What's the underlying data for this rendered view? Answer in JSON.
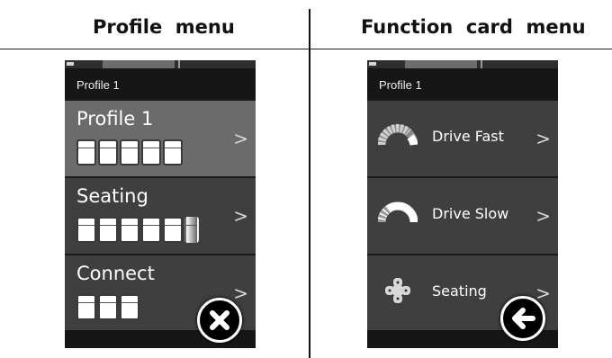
{
  "headings": {
    "left": "Profile  menu",
    "right": "Function  card  menu"
  },
  "profile_menu": {
    "title": "Profile 1",
    "chevron": ">",
    "items": [
      {
        "label": "Profile 1",
        "segments": 5,
        "selected": true
      },
      {
        "label": "Seating",
        "segments": 6,
        "selected": false
      },
      {
        "label": "Connect",
        "segments": 3,
        "selected": false
      }
    ],
    "close_icon": "close-x-icon"
  },
  "function_menu": {
    "title": "Profile 1",
    "chevron": ">",
    "items": [
      {
        "label": "Drive Fast",
        "icon": "speed-gauge-fast-icon"
      },
      {
        "label": "Drive Slow",
        "icon": "speed-gauge-slow-icon"
      },
      {
        "label": "Seating",
        "icon": "seating-joystick-icon"
      }
    ],
    "back_icon": "back-arrow-icon"
  },
  "colors": {
    "screen_bg": "#1a1a1a",
    "row_bg": "#3f3f3f",
    "row_selected_bg": "#6b6b6b",
    "text": "#ffffff"
  }
}
